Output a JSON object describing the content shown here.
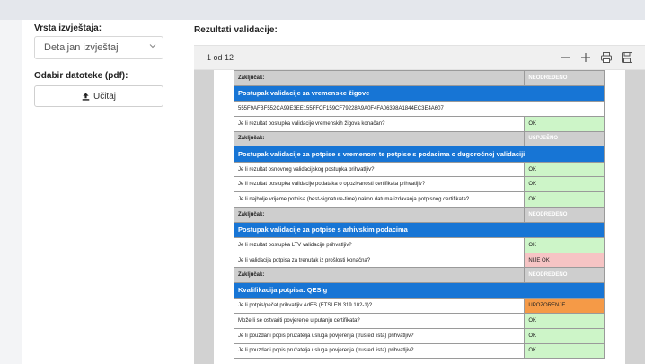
{
  "sidebar": {
    "report_type_label": "Vrsta izvještaja:",
    "report_type_value": "Detaljan izvještaj",
    "file_select_label": "Odabir datoteke (pdf):",
    "upload_button_label": "Učitaj"
  },
  "results": {
    "title": "Rezultati validacije:",
    "viewer": {
      "page_indicator": "1 od 12"
    },
    "table": {
      "rows": [
        {
          "kind": "concl",
          "q": "Zaključak:",
          "a": "NEODREĐENO",
          "status": "neo"
        },
        {
          "kind": "sec",
          "q": "Postupak validacije za vremenske žigove"
        },
        {
          "kind": "plain",
          "q": "555F9AFBF552CA99E3EE155FFCF159CF79228A9A0F4FA06398A1844EC3E4A607"
        },
        {
          "kind": "item",
          "q": "Je li rezultat postupka validacije vremenskih žigova konačan?",
          "a": "OK",
          "status": "ok"
        },
        {
          "kind": "concl",
          "q": "Zaključak:",
          "a": "USPJEŠNO",
          "status": "usp"
        },
        {
          "kind": "sec",
          "q": "Postupak validacije za potpise s vremenom te potpise s podacima o dugoročnoj validaciji"
        },
        {
          "kind": "item",
          "q": "Je li rezultat osnovnog validacijskog postupka prihvatljiv?",
          "a": "OK",
          "status": "ok"
        },
        {
          "kind": "item",
          "q": "Je li rezultat postupka validacije podataka o opozivanosti certifikata prihvatljiv?",
          "a": "OK",
          "status": "ok"
        },
        {
          "kind": "item",
          "q": "Je li najbolje vrijeme potpisa (best-signature-time) nakon datuma izdavanja potpisnog certifikata?",
          "a": "OK",
          "status": "ok"
        },
        {
          "kind": "concl",
          "q": "Zaključak:",
          "a": "NEODREĐENO",
          "status": "neo"
        },
        {
          "kind": "sec",
          "q": "Postupak validacije za potpise s arhivskim podacima"
        },
        {
          "kind": "item",
          "q": "Je li rezultat postupka LTV validacije prihvatljiv?",
          "a": "OK",
          "status": "ok"
        },
        {
          "kind": "item",
          "q": "Je li validacija potpisa za trenutak iz prošlosti konačna?",
          "a": "NIJE OK",
          "status": "nijeok"
        },
        {
          "kind": "concl",
          "q": "Zaključak:",
          "a": "NEODREĐENO",
          "status": "neo"
        },
        {
          "kind": "sec",
          "q": "Kvalifikacija potpisa: QESig"
        },
        {
          "kind": "item",
          "q": "Je li potpis/pečat prihvatljiv AdES (ETSI EN 319 102-1)?",
          "a": "UPOZORENJE",
          "status": "upoz"
        },
        {
          "kind": "item",
          "q": "Može li se ostvariti povjerenje u putanju certifikata?",
          "a": "OK",
          "status": "ok"
        },
        {
          "kind": "item",
          "q": "Je li pouzdani popis pružatelja usluga povjerenja (trusted lista) prihvatljiv?",
          "a": "OK",
          "status": "ok"
        },
        {
          "kind": "item",
          "q": "Je li pouzdani popis pružatelja usluga povjerenja (trusted lista) prihvatljiv?",
          "a": "OK",
          "status": "ok"
        }
      ]
    }
  },
  "icons": {
    "chevron": "chevron-down-icon",
    "upload": "upload-icon",
    "zoom_out": "zoom-out-icon",
    "zoom_in": "zoom-in-icon",
    "print": "print-icon",
    "save": "save-icon"
  },
  "colors": {
    "section_header": "#1775d5",
    "conclusion_row": "#cecece",
    "status_ok": "#cdf5c8",
    "status_not_ok": "#f6c4c4",
    "status_warning": "#f59a47",
    "status_indeterminate": "#f5a00e",
    "status_passed": "#2fb82f"
  }
}
